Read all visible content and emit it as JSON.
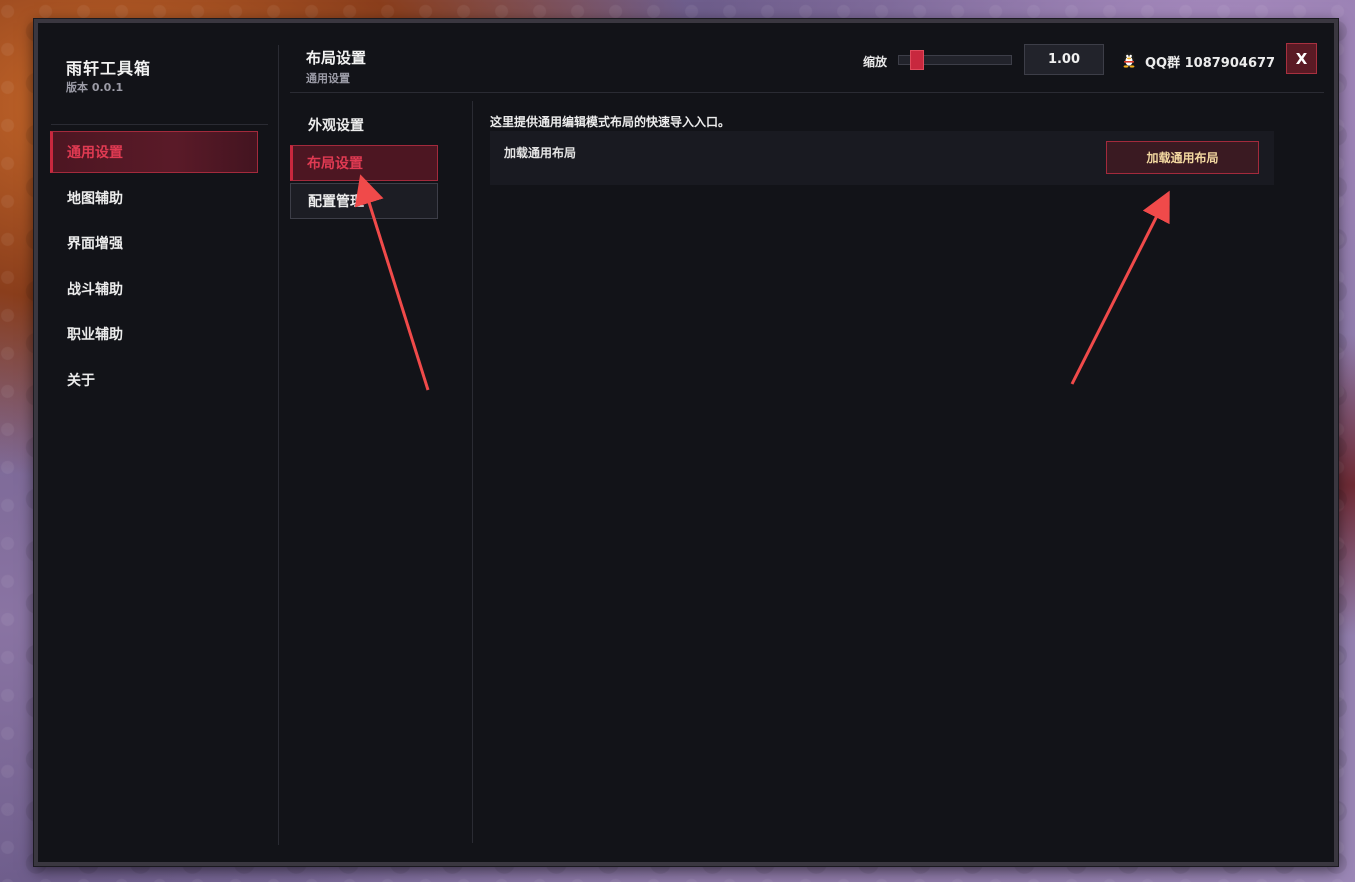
{
  "app": {
    "title": "雨轩工具箱",
    "version": "版本 0.0.1"
  },
  "sidebar": {
    "items": [
      {
        "label": "通用设置",
        "active": true
      },
      {
        "label": "地图辅助"
      },
      {
        "label": "界面增强"
      },
      {
        "label": "战斗辅助"
      },
      {
        "label": "职业辅助"
      },
      {
        "label": "关于"
      }
    ]
  },
  "header": {
    "title": "布局设置",
    "subtitle": "通用设置",
    "zoom_label": "缩放",
    "zoom_level": 0.08,
    "zoom_value": "1.00",
    "qq_icon": "qq-penguin-icon",
    "qq_text": "QQ群 1087904677",
    "close_label": "X"
  },
  "subnav": {
    "items": [
      {
        "label": "外观设置"
      },
      {
        "label": "布局设置",
        "active": true
      },
      {
        "label": "配置管理"
      }
    ]
  },
  "content": {
    "description": "这里提供通用编辑模式布局的快速导入入口。",
    "row_label": "加载通用布局",
    "row_button": "加载通用布局"
  },
  "colors": {
    "accent": "#c8283e",
    "window_bg": "#121318",
    "button_text": "#f2d7a0",
    "annotation_arrow": "#f04a4a"
  }
}
